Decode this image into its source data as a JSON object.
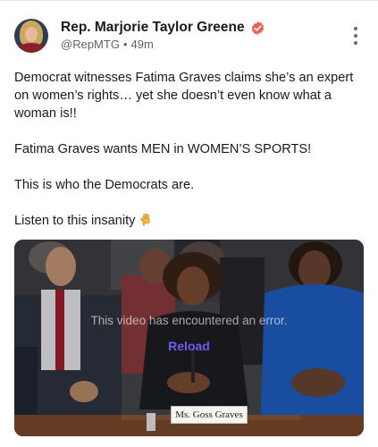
{
  "post": {
    "author": {
      "display_name": "Rep. Marjorie Taylor Greene",
      "handle": "@RepMTG",
      "separator": "•",
      "time_ago": "49m",
      "verified_badge_icon": "verified-badge-icon",
      "verified_color": "#ec5f52"
    },
    "more_menu_icon": "more-vertical-icon",
    "paragraphs": [
      "Democrat witnesses Fatima Graves claims she’s an expert on women’s rights… yet she doesn’t even know what a woman is!!",
      "Fatima Graves wants MEN in WOMEN’S SPORTS!",
      "This is who the Democrats are."
    ],
    "last_paragraph": "Listen to this insanity",
    "last_paragraph_emoji": "pointing-down-hand-emoji",
    "video": {
      "error_message": "This video has encountered an error.",
      "reload_label": "Reload",
      "reload_color": "#6e5cf0",
      "nameplate_text": "Ms. Goss Graves"
    }
  }
}
